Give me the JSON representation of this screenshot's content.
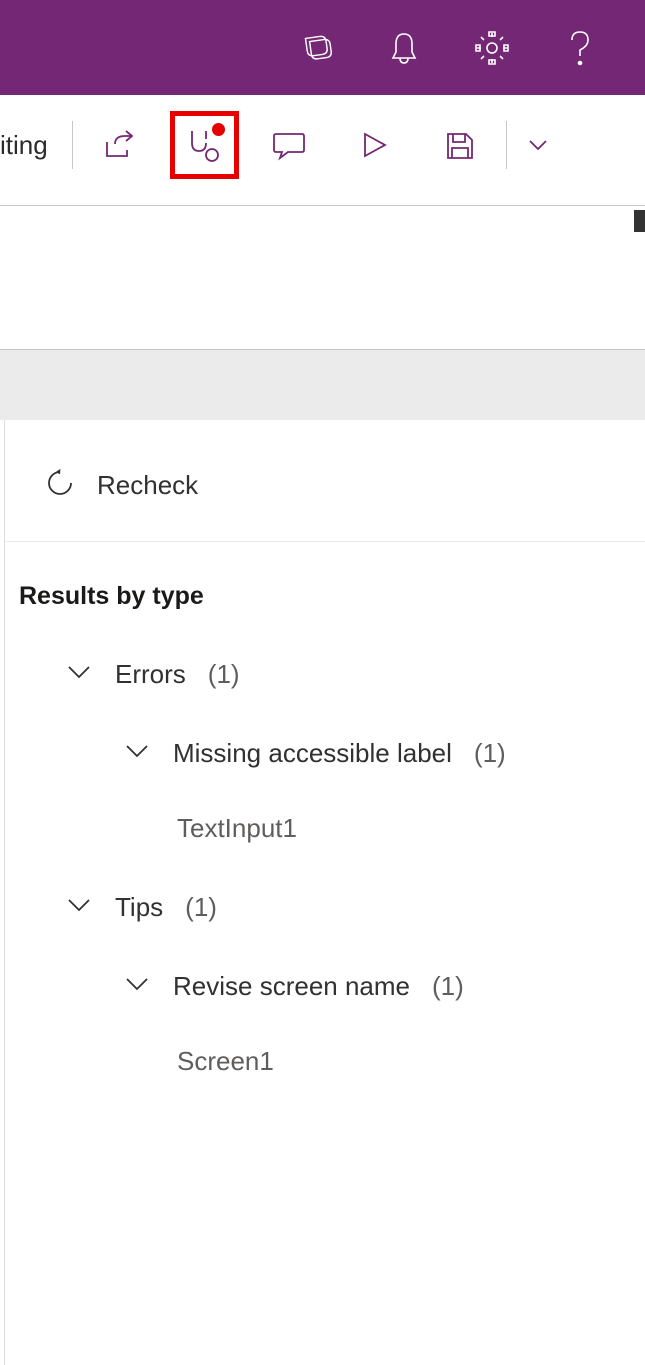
{
  "toolbar": {
    "editing_suffix": "iting"
  },
  "panel": {
    "recheck_label": "Recheck",
    "results_title": "Results by type",
    "groups": [
      {
        "label": "Errors",
        "count": "(1)",
        "subgroups": [
          {
            "label": "Missing accessible label",
            "count": "(1)",
            "items": [
              "TextInput1"
            ]
          }
        ]
      },
      {
        "label": "Tips",
        "count": "(1)",
        "subgroups": [
          {
            "label": "Revise screen name",
            "count": "(1)",
            "items": [
              "Screen1"
            ]
          }
        ]
      }
    ]
  }
}
